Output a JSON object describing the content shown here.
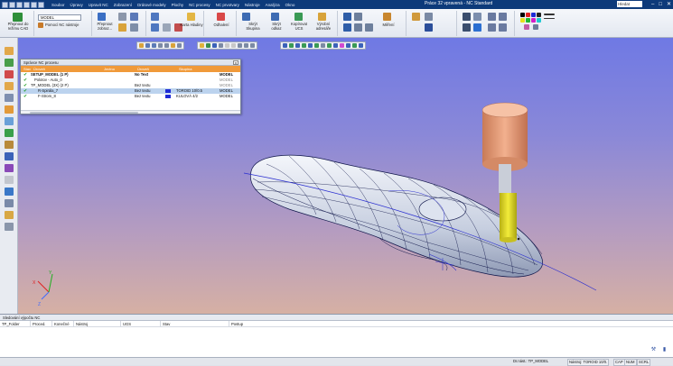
{
  "window": {
    "title": "Práce 32 vpravená - NC Standard",
    "help_placeholder": "Hledat"
  },
  "menu": [
    "Soubor",
    "Úpravy",
    "Upravit NC",
    "Zobrazení",
    "Drátové modely",
    "Plochy",
    "NC procesy",
    "NC prvotvary",
    "Nástroje",
    "Analýza",
    "Okno"
  ],
  "ribbon": {
    "model_combo": "MODEL",
    "buttons": [
      {
        "label": "Přepnout do\nrežimu CAD"
      },
      {
        "label": "Pomocí NC nástroje"
      },
      {
        "label": "Přepnout\nzobraz..."
      },
      {
        "label": "Karta Hladiny"
      },
      {
        "label": "Odhalení"
      },
      {
        "label": "Skrýt\nSkupina"
      },
      {
        "label": "Skrýt\nodkaz"
      },
      {
        "label": "Kopírovat\nUCS"
      },
      {
        "label": "Výrobní\nadresáře"
      },
      {
        "label": "Měření"
      }
    ]
  },
  "nc_panel": {
    "title": "Správce NC procesu",
    "close": "x",
    "columns": [
      "Stav",
      "Úroveň",
      "Jméno",
      "Úroveň",
      "Skupina"
    ],
    "rows": [
      {
        "name": "SETUP_MODEL (1 P)",
        "text": "No Text",
        "extra": "",
        "model": "MODEL",
        "bold": true,
        "selected": false
      },
      {
        "name": "Polotov - Auto_0",
        "text": "",
        "extra": "",
        "model": "MODEL",
        "bold": false,
        "selected": false
      },
      {
        "name": "TP_MODEL (3X) (2 P)",
        "text": "Bez textu",
        "extra": "",
        "model": "MODEL",
        "bold": false,
        "selected": false
      },
      {
        "name": "R-Spirála_7",
        "text": "Bez textu",
        "extra": "TOROID 10/0.5",
        "model": "MODEL",
        "bold": false,
        "selected": true
      },
      {
        "name": "F-Strom_8",
        "text": "Bez textu",
        "extra": "KULOVÁ 4/2",
        "model": "MODEL",
        "bold": false,
        "selected": false
      }
    ]
  },
  "bottom_panel": {
    "title": "Sledování výpočtu NC",
    "columns": [
      "TP_Folder",
      "Proced.",
      "Konečné",
      "Nástroj",
      "UGS",
      "Stav",
      "Postup"
    ]
  },
  "statusbar": {
    "model": "Dr.nást.: TP_MODEL",
    "tool": "Nástroj: TOROID 10/0.",
    "caps": "CAP",
    "num": "NUM",
    "scrl": "SCRL"
  },
  "colors": {
    "accent_orange": "#f09a3a",
    "selection_blue": "#bcd3ee",
    "tool_yellow": "#e8e12a",
    "holder_copper": "#e7a07c"
  }
}
